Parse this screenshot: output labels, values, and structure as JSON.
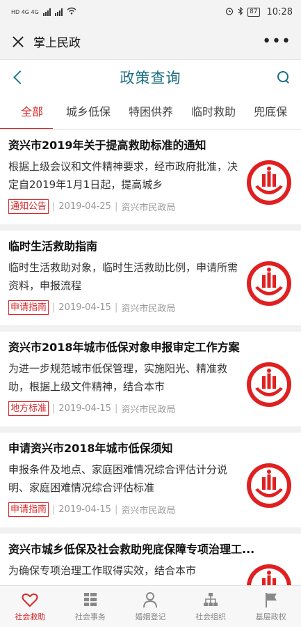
{
  "status_bar": {
    "network": "HD 4G 4G",
    "battery": "87",
    "time": "10:28"
  },
  "app_bar": {
    "title": "掌上民政",
    "more": "•••"
  },
  "page": {
    "title": "政策查询"
  },
  "tabs": [
    {
      "label": "全部",
      "active": true
    },
    {
      "label": "城乡低保",
      "active": false
    },
    {
      "label": "特困供养",
      "active": false
    },
    {
      "label": "临时救助",
      "active": false
    },
    {
      "label": "兜底保",
      "active": false
    }
  ],
  "articles": [
    {
      "title": "资兴市2019年关于提高救助标准的通知",
      "summary": "根据上级会议和文件精神要求，经市政府批准，决定自2019年1月1日起，提高城乡",
      "tag": "通知公告",
      "date": "2019-04-25",
      "source": "资兴市民政局"
    },
    {
      "title": "临时生活救助指南",
      "summary": "临时生活救助对象，临时生活救助比例，申请所需资料，申报流程",
      "tag": "申请指南",
      "date": "2019-04-15",
      "source": "资兴市民政局"
    },
    {
      "title": "资兴市2018年城市低保对象申报审定工作方案",
      "summary": "为进一步规范城市低保管理，实施阳光、精准救助，根据上级文件精神，结合本市",
      "tag": "地方标准",
      "date": "2019-04-15",
      "source": "资兴市民政局"
    },
    {
      "title": "申请资兴市2018年城市低保须知",
      "summary": "申报条件及地点、家庭困难情况综合评估计分说明、家庭困难情况综合评估标准",
      "tag": "申请指南",
      "date": "2019-04-15",
      "source": "资兴市民政局"
    },
    {
      "title": "资兴市城乡低保及社会救助兜底保障专项治理工...",
      "summary": "为确保专项治理工作取得实效，结合本市",
      "tag": "",
      "date": "",
      "source": ""
    }
  ],
  "bottom_nav": [
    {
      "label": "社会救助",
      "icon": "heart-icon",
      "active": true
    },
    {
      "label": "社会事务",
      "icon": "list-icon",
      "active": false
    },
    {
      "label": "婚姻登记",
      "icon": "people-icon",
      "active": false
    },
    {
      "label": "社会组织",
      "icon": "org-icon",
      "active": false
    },
    {
      "label": "基层政权",
      "icon": "flag-icon",
      "active": false
    }
  ],
  "colors": {
    "accent": "#d7262a",
    "header_text": "#1a6e80"
  }
}
